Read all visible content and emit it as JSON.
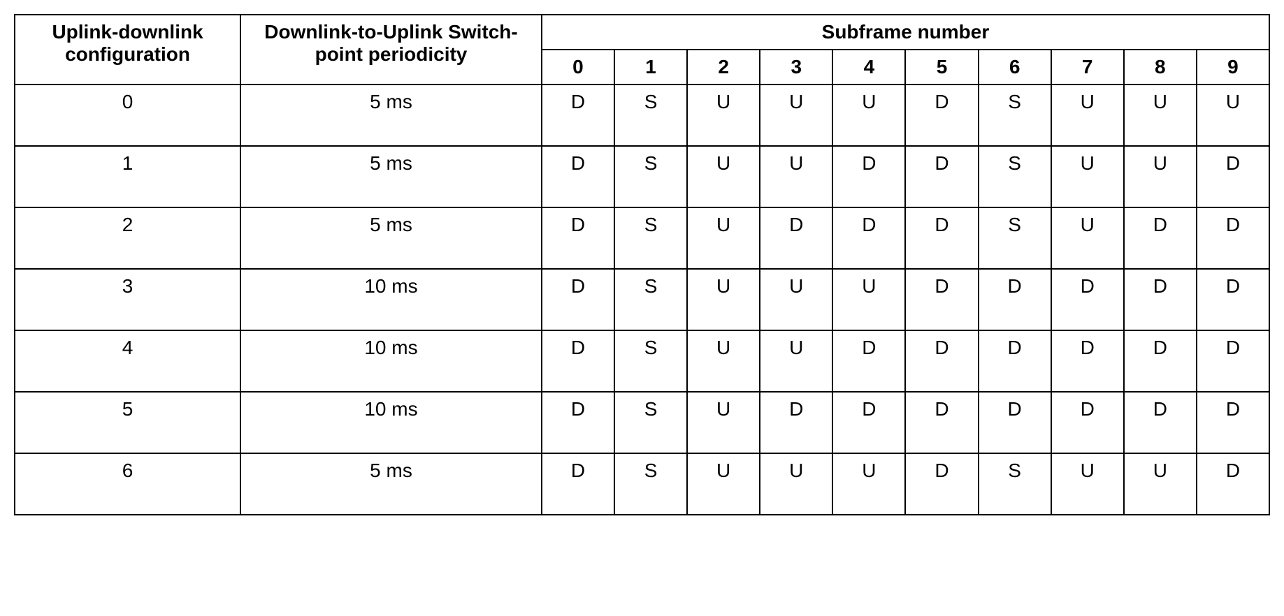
{
  "chart_data": {
    "type": "table",
    "headers": {
      "config": "Uplink-downlink configuration",
      "periodicity": "Downlink-to-Uplink Switch-point periodicity",
      "subframe_group": "Subframe number",
      "subframes": [
        "0",
        "1",
        "2",
        "3",
        "4",
        "5",
        "6",
        "7",
        "8",
        "9"
      ]
    },
    "rows": [
      {
        "config": "0",
        "periodicity": "5 ms",
        "sf": [
          "D",
          "S",
          "U",
          "U",
          "U",
          "D",
          "S",
          "U",
          "U",
          "U"
        ]
      },
      {
        "config": "1",
        "periodicity": "5 ms",
        "sf": [
          "D",
          "S",
          "U",
          "U",
          "D",
          "D",
          "S",
          "U",
          "U",
          "D"
        ]
      },
      {
        "config": "2",
        "periodicity": "5 ms",
        "sf": [
          "D",
          "S",
          "U",
          "D",
          "D",
          "D",
          "S",
          "U",
          "D",
          "D"
        ]
      },
      {
        "config": "3",
        "periodicity": "10 ms",
        "sf": [
          "D",
          "S",
          "U",
          "U",
          "U",
          "D",
          "D",
          "D",
          "D",
          "D"
        ]
      },
      {
        "config": "4",
        "periodicity": "10 ms",
        "sf": [
          "D",
          "S",
          "U",
          "U",
          "D",
          "D",
          "D",
          "D",
          "D",
          "D"
        ]
      },
      {
        "config": "5",
        "periodicity": "10 ms",
        "sf": [
          "D",
          "S",
          "U",
          "D",
          "D",
          "D",
          "D",
          "D",
          "D",
          "D"
        ]
      },
      {
        "config": "6",
        "periodicity": "5 ms",
        "sf": [
          "D",
          "S",
          "U",
          "U",
          "U",
          "D",
          "S",
          "U",
          "U",
          "D"
        ]
      }
    ]
  }
}
